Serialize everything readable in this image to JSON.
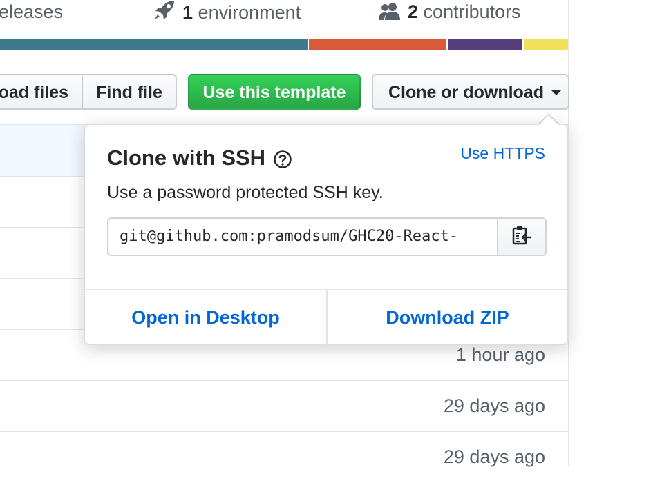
{
  "summary": {
    "releases_label": "eleases",
    "environment_count": "1",
    "environment_label": "environment",
    "contributors_count": "2",
    "contributors_label": "contributors"
  },
  "language_bar": {
    "segments": [
      {
        "color": "#3e7a8e",
        "share": 0.541
      },
      {
        "color": "#d95a38",
        "share": 0.243
      },
      {
        "color": "#563d7c",
        "share": 0.131
      },
      {
        "color": "#f1e05a",
        "share": 0.079
      }
    ]
  },
  "toolbar": {
    "upload_label": "oad files",
    "find_file_label": "Find file",
    "template_label": "Use this template",
    "clone_label": "Clone or download"
  },
  "clone_dropdown": {
    "title": "Clone with SSH",
    "use_https_label": "Use HTTPS",
    "description": "Use a password protected SSH key.",
    "url_value": "git@github.com:pramodsum/GHC20-React-",
    "open_desktop_label": "Open in Desktop",
    "download_zip_label": "Download ZIP"
  },
  "file_rows": [
    {
      "age": ""
    },
    {
      "age": ""
    },
    {
      "age": ""
    },
    {
      "age": ""
    },
    {
      "age": "1 hour ago"
    },
    {
      "age": "29 days ago"
    },
    {
      "age": "29 days ago"
    }
  ],
  "colors": {
    "accent_blue": "#0366d6",
    "green_button": "#2ea44f",
    "border": "#e1e4e8"
  }
}
